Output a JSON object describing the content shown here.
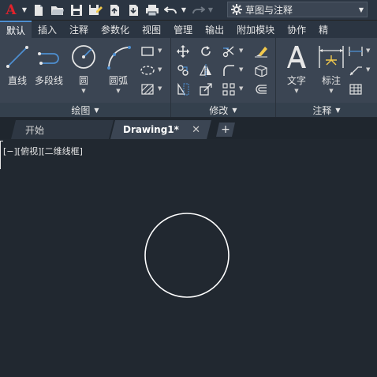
{
  "qat": {
    "app_letter": "A",
    "workspace": "草图与注释"
  },
  "ribbon_tabs": [
    {
      "label": "默认",
      "active": true
    },
    {
      "label": "插入"
    },
    {
      "label": "注释"
    },
    {
      "label": "参数化"
    },
    {
      "label": "视图"
    },
    {
      "label": "管理"
    },
    {
      "label": "输出"
    },
    {
      "label": "附加模块"
    },
    {
      "label": "协作"
    },
    {
      "label": "精"
    }
  ],
  "panels": {
    "draw": {
      "title": "绘图",
      "tools": {
        "line": "直线",
        "polyline": "多段线",
        "circle": "圆",
        "arc": "圆弧"
      }
    },
    "modify": {
      "title": "修改"
    },
    "annotation": {
      "title": "注释",
      "tools": {
        "text": "文字",
        "dimension": "标注"
      }
    }
  },
  "file_tabs": {
    "start": "开始",
    "drawing": "Drawing1*",
    "close_glyph": "✕",
    "new_glyph": "+"
  },
  "canvas": {
    "viewport_label": "[−][俯视][二维线框]"
  },
  "colors": {
    "background": "#212830",
    "ribbon": "#3b4553",
    "accent": "#4e8fd1",
    "app_logo": "#e2222b",
    "icon_yellow": "#f2c94c"
  }
}
